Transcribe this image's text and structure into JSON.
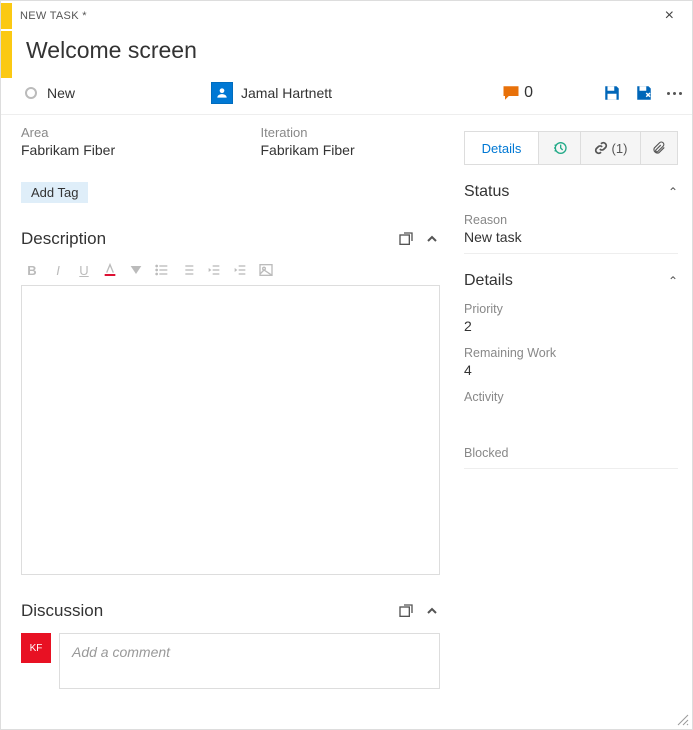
{
  "header": {
    "type_label": "NEW TASK *",
    "title": "Welcome screen"
  },
  "info": {
    "state": "New",
    "assignee": "Jamal Hartnett",
    "comment_count": "0"
  },
  "fields": {
    "area_label": "Area",
    "area_value": "Fabrikam Fiber",
    "iteration_label": "Iteration",
    "iteration_value": "Fabrikam Fiber"
  },
  "tags": {
    "add_tag_label": "Add Tag"
  },
  "sections": {
    "description": "Description",
    "discussion": "Discussion"
  },
  "tabs": {
    "details": "Details",
    "links_count": "(1)"
  },
  "sidebar": {
    "status_title": "Status",
    "reason_label": "Reason",
    "reason_value": "New task",
    "details_title": "Details",
    "priority_label": "Priority",
    "priority_value": "2",
    "remaining_label": "Remaining Work",
    "remaining_value": "4",
    "activity_label": "Activity",
    "blocked_label": "Blocked"
  },
  "discussion": {
    "user_badge": "KF",
    "placeholder": "Add a comment"
  }
}
